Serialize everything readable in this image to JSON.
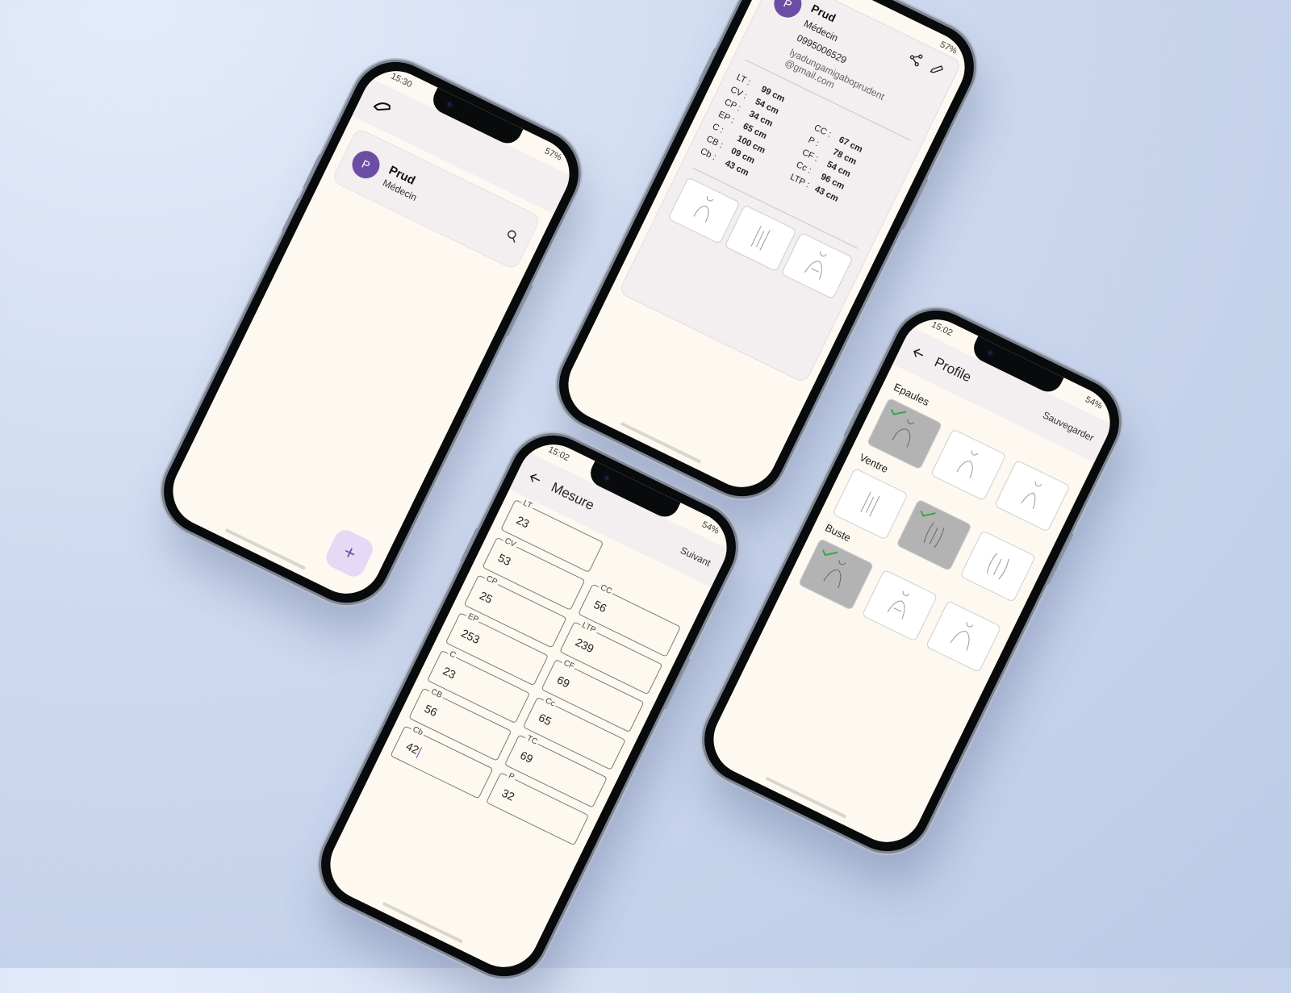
{
  "phone1": {
    "status_time": "15:30",
    "status_battery": "57%",
    "contact": {
      "initial": "P",
      "name": "Prud",
      "role": "Médecin"
    },
    "fab_label": "+"
  },
  "phone2": {
    "status_battery": "57%",
    "contact": {
      "initial": "P",
      "name": "Prud",
      "role": "Médecin",
      "phone": "0995006529",
      "email": "lyadungamigaboprudent@gmail.com"
    },
    "measures_left": [
      {
        "k": "LT :",
        "v": "99 cm"
      },
      {
        "k": "CV :",
        "v": "54 cm"
      },
      {
        "k": "CP :",
        "v": "34 cm"
      },
      {
        "k": "EP :",
        "v": "65 cm"
      },
      {
        "k": "C :",
        "v": "100 cm"
      },
      {
        "k": "CB :",
        "v": "09 cm"
      },
      {
        "k": "Cb :",
        "v": "43 cm"
      }
    ],
    "measures_right": [
      {
        "k": "CC :",
        "v": "67 cm"
      },
      {
        "k": "P :",
        "v": "78 cm"
      },
      {
        "k": "CF :",
        "v": "54 cm"
      },
      {
        "k": "Cc :",
        "v": "96 cm"
      },
      {
        "k": "LTP :",
        "v": "43 cm"
      }
    ]
  },
  "phone3": {
    "status_time": "15:02",
    "status_battery": "54%",
    "title": "Mesure",
    "action": "Suivant",
    "fields_left": [
      {
        "label": "LT",
        "value": "23"
      },
      {
        "label": "CV",
        "value": "53"
      },
      {
        "label": "CP",
        "value": "25"
      },
      {
        "label": "EP",
        "value": "253"
      },
      {
        "label": "C",
        "value": "23"
      },
      {
        "label": "CB",
        "value": "56"
      },
      {
        "label": "Cb",
        "value": "42"
      }
    ],
    "fields_right": [
      {
        "label": "",
        "value": ""
      },
      {
        "label": "CC",
        "value": "56"
      },
      {
        "label": "LTP",
        "value": "239"
      },
      {
        "label": "CF",
        "value": "69"
      },
      {
        "label": "Cc",
        "value": "65"
      },
      {
        "label": "TC",
        "value": "69"
      },
      {
        "label": "P",
        "value": "32"
      }
    ]
  },
  "phone4": {
    "status_time": "15:02",
    "status_battery": "54%",
    "title": "Profile",
    "action": "Sauvegarder",
    "sections": [
      {
        "label": "Epaules"
      },
      {
        "label": "Ventre"
      },
      {
        "label": "Buste"
      }
    ]
  }
}
